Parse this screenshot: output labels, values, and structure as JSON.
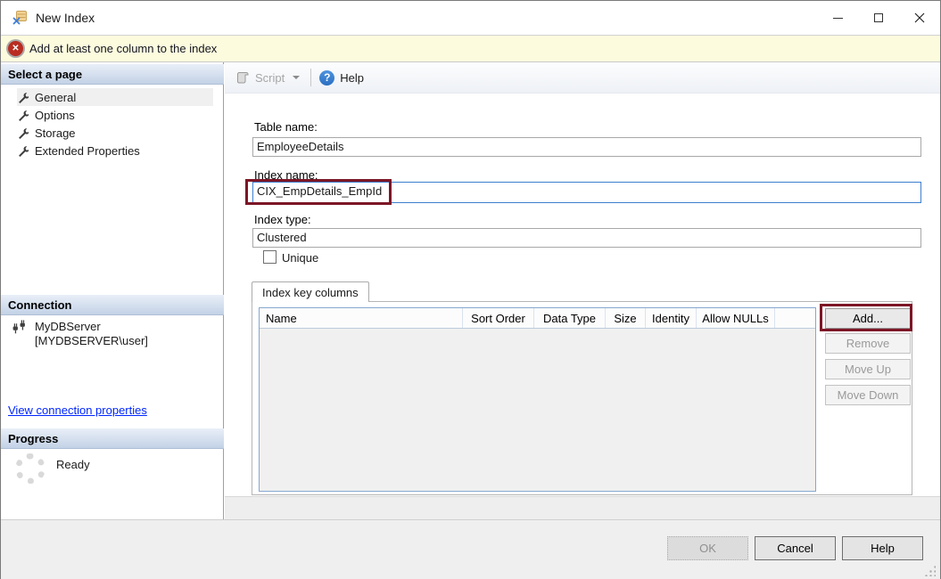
{
  "window": {
    "title": "New Index"
  },
  "alert": {
    "message": "Add at least one column to the index"
  },
  "sidebar": {
    "select_page_title": "Select a page",
    "pages": [
      {
        "label": "General",
        "selected": true
      },
      {
        "label": "Options",
        "selected": false
      },
      {
        "label": "Storage",
        "selected": false
      },
      {
        "label": "Extended Properties",
        "selected": false
      }
    ],
    "connection_title": "Connection",
    "connection_server": "MyDBServer",
    "connection_account": "[MYDBSERVER\\user]",
    "connection_link": "View connection properties",
    "progress_title": "Progress",
    "progress_status": "Ready"
  },
  "toolbar": {
    "script_label": "Script",
    "help_label": "Help"
  },
  "form": {
    "table_name_label": "Table name:",
    "table_name_value": "EmployeeDetails",
    "index_name_label": "Index name:",
    "index_name_value": "CIX_EmpDetails_EmpId",
    "index_type_label": "Index type:",
    "index_type_value": "Clustered",
    "unique_label": "Unique",
    "unique_checked": false
  },
  "key_columns": {
    "tab_label": "Index key columns",
    "columns": [
      "Name",
      "Sort Order",
      "Data Type",
      "Size",
      "Identity",
      "Allow NULLs"
    ],
    "rows": [],
    "buttons": {
      "add": {
        "label": "Add...",
        "enabled": true,
        "highlighted": true
      },
      "remove": {
        "label": "Remove",
        "enabled": false
      },
      "move_up": {
        "label": "Move Up",
        "enabled": false
      },
      "move_down": {
        "label": "Move Down",
        "enabled": false
      }
    }
  },
  "footer": {
    "ok": {
      "label": "OK",
      "enabled": false
    },
    "cancel": {
      "label": "Cancel",
      "enabled": true
    },
    "help": {
      "label": "Help",
      "enabled": true
    }
  },
  "colors": {
    "annotation": "#7c1626",
    "link_blue": "#0026ff",
    "alert_bg": "#fcfbde",
    "focus_border": "#3e7fce"
  }
}
